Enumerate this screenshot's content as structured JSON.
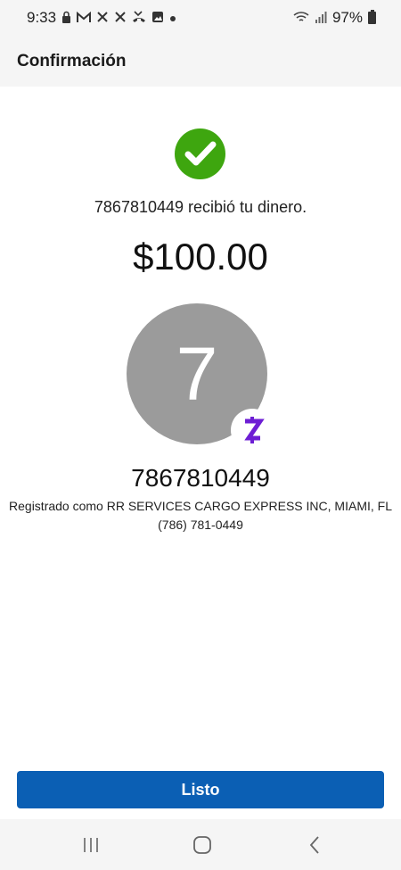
{
  "status_bar": {
    "time": "9:33",
    "battery": "97%",
    "icons": [
      "lock-icon",
      "gmail-icon",
      "x-icon",
      "x-icon",
      "missed-call-icon",
      "gallery-icon",
      "dot-icon",
      "wifi-icon",
      "signal-icon",
      "battery-icon"
    ]
  },
  "header": {
    "title": "Confirmación"
  },
  "confirmation": {
    "message": "7867810449 recibió tu dinero.",
    "amount": "$100.00"
  },
  "recipient": {
    "avatar_initial": "7",
    "name": "7867810449",
    "registered_as": "Registrado como RR SERVICES CARGO EXPRESS INC, MIAMI, FL",
    "phone": "(786) 781-0449"
  },
  "actions": {
    "done_label": "Listo"
  },
  "colors": {
    "success": "#3ea60f",
    "primary_button": "#0b5fb4",
    "zelle_purple": "#6d1ed4",
    "avatar_bg": "#9b9b9b"
  },
  "nav": {
    "icons": [
      "recent-apps-icon",
      "home-icon",
      "back-icon"
    ]
  }
}
